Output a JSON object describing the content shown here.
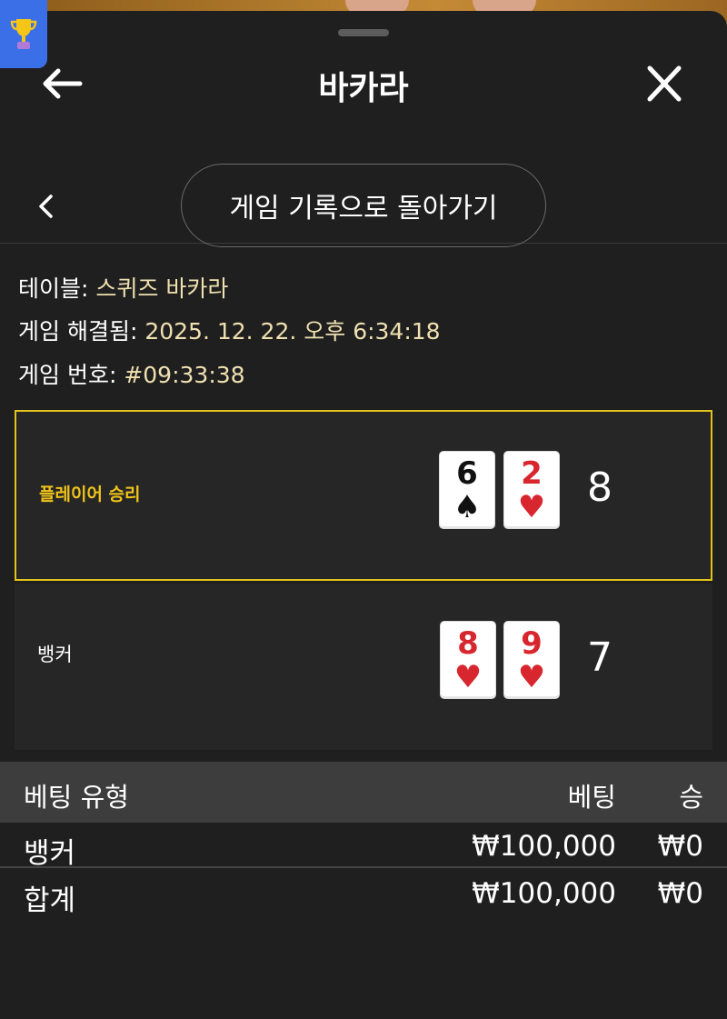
{
  "header": {
    "title": "바카라"
  },
  "nav": {
    "back_history_label": "게임 기록으로 돌아가기"
  },
  "info": {
    "table_label": "테이블: ",
    "table_value": "스퀴즈 바카라",
    "resolved_label": "게임 해결됨: ",
    "resolved_value": "2025. 12. 22. 오후 6:34:18",
    "game_no_label": "게임 번호: ",
    "game_no_value": "#09:33:38"
  },
  "player": {
    "label": "플레이어 승리",
    "cards": [
      {
        "rank": "6",
        "suit": "♠",
        "color": "black"
      },
      {
        "rank": "2",
        "suit": "♥",
        "color": "red"
      }
    ],
    "score": "8"
  },
  "banker": {
    "label": "뱅커",
    "cards": [
      {
        "rank": "8",
        "suit": "♥",
        "color": "red"
      },
      {
        "rank": "9",
        "suit": "♥",
        "color": "red"
      }
    ],
    "score": "7"
  },
  "bets": {
    "headers": {
      "type": "베팅 유형",
      "bet": "베팅",
      "win": "승"
    },
    "rows": [
      {
        "type": "뱅커",
        "bet": "₩100,000",
        "win": "₩0"
      }
    ],
    "total": {
      "type": "합계",
      "bet": "₩100,000",
      "win": "₩0"
    }
  },
  "colors": {
    "accent": "#e2c21b",
    "background": "#1f1f1f",
    "card_red": "#d8262e",
    "badge_blue": "#3b6fe8"
  }
}
